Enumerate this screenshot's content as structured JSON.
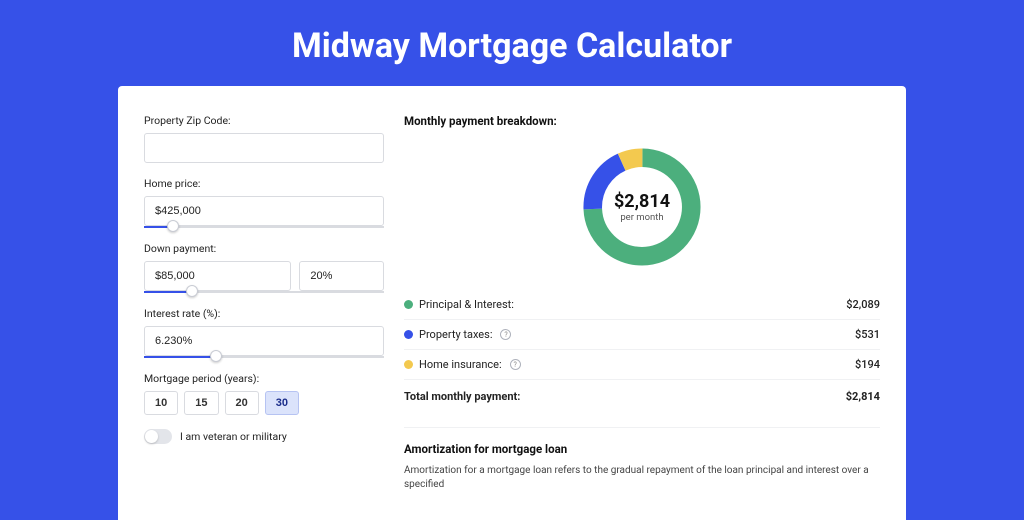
{
  "pageTitle": "Midway Mortgage Calculator",
  "left": {
    "zip": {
      "label": "Property Zip Code:",
      "value": ""
    },
    "homePrice": {
      "label": "Home price:",
      "value": "$425,000",
      "sliderPct": 12
    },
    "downPayment": {
      "label": "Down payment:",
      "amount": "$85,000",
      "percent": "20%",
      "sliderPct": 20
    },
    "interestRate": {
      "label": "Interest rate (%):",
      "value": "6.230%",
      "sliderPct": 30
    },
    "period": {
      "label": "Mortgage period (years):",
      "options": [
        "10",
        "15",
        "20",
        "30"
      ],
      "active": "30"
    },
    "veteran": {
      "label": "I am veteran or military",
      "checked": false
    }
  },
  "breakdown": {
    "title": "Monthly payment breakdown:",
    "centerAmount": "$2,814",
    "centerSub": "per month",
    "items": [
      {
        "label": "Principal & Interest:",
        "value": "$2,089",
        "color": "#4caf7d",
        "info": false
      },
      {
        "label": "Property taxes:",
        "value": "$531",
        "color": "#3651e8",
        "info": true
      },
      {
        "label": "Home insurance:",
        "value": "$194",
        "color": "#f3c94f",
        "info": true
      }
    ],
    "totalLabel": "Total monthly payment:",
    "totalValue": "$2,814"
  },
  "amort": {
    "title": "Amortization for mortgage loan",
    "text": "Amortization for a mortgage loan refers to the gradual repayment of the loan principal and interest over a specified"
  },
  "chart_data": {
    "type": "pie",
    "title": "Monthly payment breakdown",
    "categories": [
      "Principal & Interest",
      "Property taxes",
      "Home insurance"
    ],
    "values": [
      2089,
      531,
      194
    ],
    "total": 2814,
    "unit": "USD per month",
    "colors": [
      "#4caf7d",
      "#3651e8",
      "#f3c94f"
    ]
  }
}
